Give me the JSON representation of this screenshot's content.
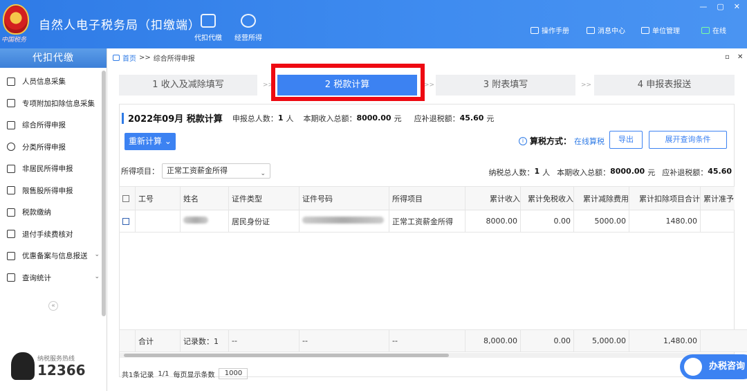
{
  "header": {
    "logo_text": "中国税务",
    "app_title": "自然人电子税务局（扣缴端）",
    "tools": [
      {
        "label": "代扣代缴",
        "icon": "wallet-icon"
      },
      {
        "label": "经营所得",
        "icon": "coins-icon"
      }
    ],
    "nav": [
      {
        "label": "操作手册",
        "icon": "manual-icon"
      },
      {
        "label": "消息中心",
        "icon": "mail-icon"
      },
      {
        "label": "单位管理",
        "icon": "building-icon"
      },
      {
        "label": "在线",
        "icon": "monitor-icon"
      }
    ],
    "window_controls": {
      "minimize": "—",
      "restore": "▢",
      "close": "✕"
    }
  },
  "sidebar": {
    "title": "代扣代缴",
    "items": [
      {
        "label": "人员信息采集",
        "icon": "person-icon"
      },
      {
        "label": "专项附加扣除信息采集",
        "icon": "grid-icon"
      },
      {
        "label": "综合所得申报",
        "icon": "layers-icon"
      },
      {
        "label": "分类所得申报",
        "icon": "pie-icon"
      },
      {
        "label": "非居民所得申报",
        "icon": "person-plus-icon"
      },
      {
        "label": "限售股所得申报",
        "icon": "bar-chart-icon"
      },
      {
        "label": "税款缴纳",
        "icon": "folder-icon"
      },
      {
        "label": "退付手续费核对",
        "icon": "checklist-icon"
      },
      {
        "label": "优惠备案与信息报送",
        "icon": "doc-icon",
        "chevron": "⌄"
      },
      {
        "label": "查询统计",
        "icon": "search-list-icon",
        "chevron": "⌄"
      }
    ],
    "collapse_glyph": "«",
    "hotline_label": "纳税服务热线",
    "hotline_number": "12366"
  },
  "breadcrumb": {
    "home": "首页",
    "sep": ">>",
    "current": "综合所得申报"
  },
  "main_controls": {
    "minimize": "▫",
    "close": "✕"
  },
  "steps": [
    {
      "label": "1 收入及减除填写",
      "active": false
    },
    {
      "label": "2 税款计算",
      "active": true
    },
    {
      "label": "3 附表填写",
      "active": false
    },
    {
      "label": "4 申报表报送",
      "active": false
    }
  ],
  "step_sep": ">>",
  "summary": {
    "period_title": "2022年09月  税款计算",
    "count_label": "申报总人数：",
    "count_value": "1",
    "count_unit": "人",
    "income_label": "本期收入总额：",
    "income_value": "8000.00",
    "income_unit": "元",
    "refund_label": "应补退税额：",
    "refund_value": "45.60",
    "refund_unit": "元"
  },
  "recalc_button": "重新计算",
  "tax_mode": {
    "label": "算税方式：",
    "value": "在线算税"
  },
  "buttons": {
    "export": "导出",
    "expand_query": "展开查询条件"
  },
  "filter": {
    "label": "所得项目：",
    "selected": "正常工资薪金所得"
  },
  "totals2": {
    "taxpayers_label": "纳税总人数：",
    "taxpayers_value": "1",
    "taxpayers_unit": "人",
    "income_label": "本期收入总额：",
    "income_value": "8000.00",
    "income_unit": "元",
    "refund_label": "应补退税额：",
    "refund_value": "45.60"
  },
  "table": {
    "headers": [
      "",
      "工号",
      "姓名",
      "证件类型",
      "证件号码",
      "所得项目",
      "累计收入",
      "累计免税收入",
      "累计减除费用",
      "累计扣除项目合计",
      "累计准予"
    ],
    "rows": [
      {
        "id": "",
        "id_type": "居民身份证",
        "income_item": "正常工资薪金所得",
        "cum_income": "8000.00",
        "cum_exempt": "0.00",
        "cum_deduction": "5000.00",
        "cum_items": "1480.00"
      }
    ],
    "footer": {
      "label": "合计",
      "records": "记录数：1",
      "d1": "--",
      "d2": "--",
      "d3": "--",
      "cum_income": "8,000.00",
      "cum_exempt": "0.00",
      "cum_deduction": "5,000.00",
      "cum_items": "1,480.00"
    }
  },
  "pager": {
    "total": "共1条记录",
    "page": "1/1",
    "per_page_label": "每页显示条数",
    "per_page": "1000"
  },
  "consult": "办税咨询",
  "colors": {
    "primary": "#3c82f2",
    "highlight_box": "#ee0a12"
  }
}
